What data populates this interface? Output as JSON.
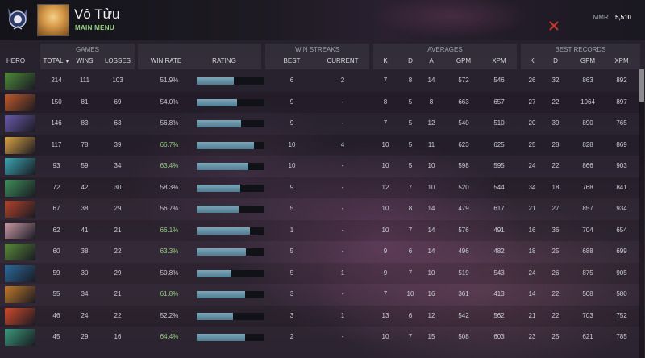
{
  "header": {
    "username": "Vô Tửu",
    "menu_link": "MAIN MENU",
    "mmr_label": "MMR",
    "mmr_value": "5,510"
  },
  "groups": {
    "games": "GAMES",
    "win_streaks": "WIN STREAKS",
    "averages": "AVERAGES",
    "best_records": "BEST RECORDS"
  },
  "columns": {
    "hero": "HERO",
    "total": "TOTAL",
    "wins": "WINS",
    "losses": "LOSSES",
    "win_rate": "WIN RATE",
    "rating": "RATING",
    "best": "BEST",
    "current": "CURRENT",
    "k": "K",
    "d": "D",
    "a": "A",
    "gpm": "GPM",
    "xpm": "XPM",
    "rk": "K",
    "rd": "D",
    "rgpm": "GPM",
    "rxpm": "XPM"
  },
  "rows": [
    {
      "icon_color": "#4f8a3a",
      "total": "214",
      "wins": "111",
      "losses": "103",
      "win_rate": "51.9%",
      "rating": 0.55,
      "best": "6",
      "current": "2",
      "k": "7",
      "d": "8",
      "a": "14",
      "gpm": "572",
      "xpm": "546",
      "rk": "26",
      "rd": "32",
      "rgpm": "863",
      "rxpm": "892"
    },
    {
      "icon_color": "#c05a2a",
      "total": "150",
      "wins": "81",
      "losses": "69",
      "win_rate": "54.0%",
      "rating": 0.59,
      "best": "9",
      "current": "-",
      "k": "8",
      "d": "5",
      "a": "8",
      "gpm": "663",
      "xpm": "657",
      "rk": "27",
      "rd": "22",
      "rgpm": "1064",
      "rxpm": "897"
    },
    {
      "icon_color": "#6a5aa8",
      "total": "146",
      "wins": "83",
      "losses": "63",
      "win_rate": "56.8%",
      "rating": 0.66,
      "best": "9",
      "current": "-",
      "k": "7",
      "d": "5",
      "a": "12",
      "gpm": "540",
      "xpm": "510",
      "rk": "20",
      "rd": "39",
      "rgpm": "890",
      "rxpm": "765"
    },
    {
      "icon_color": "#d7a246",
      "total": "117",
      "wins": "78",
      "losses": "39",
      "win_rate": "66.7%",
      "rating": 0.84,
      "best": "10",
      "current": "4",
      "k": "10",
      "d": "5",
      "a": "11",
      "gpm": "623",
      "xpm": "625",
      "rk": "25",
      "rd": "28",
      "rgpm": "828",
      "rxpm": "869"
    },
    {
      "icon_color": "#3aa6b0",
      "total": "93",
      "wins": "59",
      "losses": "34",
      "win_rate": "63.4%",
      "rating": 0.76,
      "best": "10",
      "current": "-",
      "k": "10",
      "d": "5",
      "a": "10",
      "gpm": "598",
      "xpm": "595",
      "rk": "24",
      "rd": "22",
      "rgpm": "866",
      "rxpm": "903"
    },
    {
      "icon_color": "#3f8f5a",
      "total": "72",
      "wins": "42",
      "losses": "30",
      "win_rate": "58.3%",
      "rating": 0.64,
      "best": "9",
      "current": "-",
      "k": "12",
      "d": "7",
      "a": "10",
      "gpm": "520",
      "xpm": "544",
      "rk": "34",
      "rd": "18",
      "rgpm": "768",
      "rxpm": "841"
    },
    {
      "icon_color": "#b5442c",
      "total": "67",
      "wins": "38",
      "losses": "29",
      "win_rate": "56.7%",
      "rating": 0.62,
      "best": "5",
      "current": "-",
      "k": "10",
      "d": "8",
      "a": "14",
      "gpm": "479",
      "xpm": "617",
      "rk": "21",
      "rd": "27",
      "rgpm": "857",
      "rxpm": "934"
    },
    {
      "icon_color": "#c89aa6",
      "total": "62",
      "wins": "41",
      "losses": "21",
      "win_rate": "66.1%",
      "rating": 0.78,
      "best": "1",
      "current": "-",
      "k": "10",
      "d": "7",
      "a": "14",
      "gpm": "576",
      "xpm": "491",
      "rk": "16",
      "rd": "36",
      "rgpm": "704",
      "rxpm": "654"
    },
    {
      "icon_color": "#5a8a3a",
      "total": "60",
      "wins": "38",
      "losses": "22",
      "win_rate": "63.3%",
      "rating": 0.73,
      "best": "5",
      "current": "-",
      "k": "9",
      "d": "6",
      "a": "14",
      "gpm": "496",
      "xpm": "482",
      "rk": "18",
      "rd": "25",
      "rgpm": "688",
      "rxpm": "699"
    },
    {
      "icon_color": "#2a6a9a",
      "total": "59",
      "wins": "30",
      "losses": "29",
      "win_rate": "50.8%",
      "rating": 0.51,
      "best": "5",
      "current": "1",
      "k": "9",
      "d": "7",
      "a": "10",
      "gpm": "519",
      "xpm": "543",
      "rk": "24",
      "rd": "26",
      "rgpm": "875",
      "rxpm": "905"
    },
    {
      "icon_color": "#c07a2a",
      "total": "55",
      "wins": "34",
      "losses": "21",
      "win_rate": "61.8%",
      "rating": 0.71,
      "best": "3",
      "current": "-",
      "k": "7",
      "d": "10",
      "a": "16",
      "gpm": "361",
      "xpm": "413",
      "rk": "14",
      "rd": "22",
      "rgpm": "508",
      "rxpm": "580"
    },
    {
      "icon_color": "#d04a2a",
      "total": "46",
      "wins": "24",
      "losses": "22",
      "win_rate": "52.2%",
      "rating": 0.54,
      "best": "3",
      "current": "1",
      "k": "13",
      "d": "6",
      "a": "12",
      "gpm": "542",
      "xpm": "562",
      "rk": "21",
      "rd": "22",
      "rgpm": "703",
      "rxpm": "752"
    },
    {
      "icon_color": "#3a9a7a",
      "total": "45",
      "wins": "29",
      "losses": "16",
      "win_rate": "64.4%",
      "rating": 0.72,
      "best": "2",
      "current": "-",
      "k": "10",
      "d": "7",
      "a": "15",
      "gpm": "508",
      "xpm": "603",
      "rk": "23",
      "rd": "25",
      "rgpm": "621",
      "rxpm": "785"
    }
  ]
}
